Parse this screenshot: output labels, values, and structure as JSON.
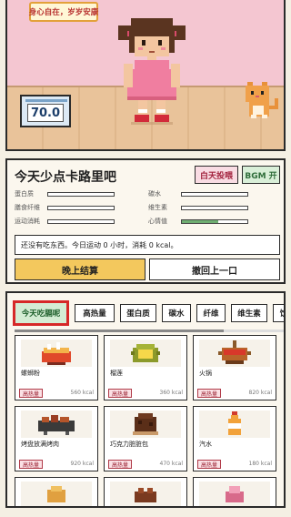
{
  "scene": {
    "banner": "身心自在，岁岁安康",
    "scale_weight": "70.0"
  },
  "status": {
    "title": "今天少点卡路里吧",
    "feed_button": "白天投喂",
    "bgm_button": "BGM 开",
    "stats": [
      {
        "label": "蛋白质",
        "level": 0
      },
      {
        "label": "碳水",
        "level": 0
      },
      {
        "label": "膳食纤维",
        "level": 0
      },
      {
        "label": "维生素",
        "level": 0
      },
      {
        "label": "运动消耗",
        "level": 0
      },
      {
        "label": "心情值",
        "level": 0.55
      }
    ],
    "message": "还没有吃东西。今日运动 0 小时，消耗 0 kcal。",
    "settle_button": "晚上结算",
    "undo_button": "撤回上一口"
  },
  "food": {
    "tabs": [
      {
        "label": "今天吃膈呢",
        "active": true
      },
      {
        "label": "高热量",
        "active": false
      },
      {
        "label": "蛋白质",
        "active": false
      },
      {
        "label": "碳水",
        "active": false
      },
      {
        "label": "纤维",
        "active": false
      },
      {
        "label": "维生素",
        "active": false
      },
      {
        "label": "饮",
        "active": false
      }
    ],
    "items": [
      {
        "name": "螺蛳粉",
        "tag": "高热量",
        "kcal": "560 kcal",
        "icon": "noodle-bowl-icon"
      },
      {
        "name": "榴莲",
        "tag": "高热量",
        "kcal": "360 kcal",
        "icon": "durian-icon"
      },
      {
        "name": "火锅",
        "tag": "高热量",
        "kcal": "820 kcal",
        "icon": "hotpot-icon"
      },
      {
        "name": "烤盘放满烤肉",
        "tag": "高热量",
        "kcal": "920 kcal",
        "icon": "bbq-grill-icon"
      },
      {
        "name": "巧克力脏脏包",
        "tag": "高热量",
        "kcal": "470 kcal",
        "icon": "chocolate-bun-icon"
      },
      {
        "name": "汽水",
        "tag": "高热量",
        "kcal": "180 kcal",
        "icon": "soda-bottle-icon"
      }
    ]
  }
}
